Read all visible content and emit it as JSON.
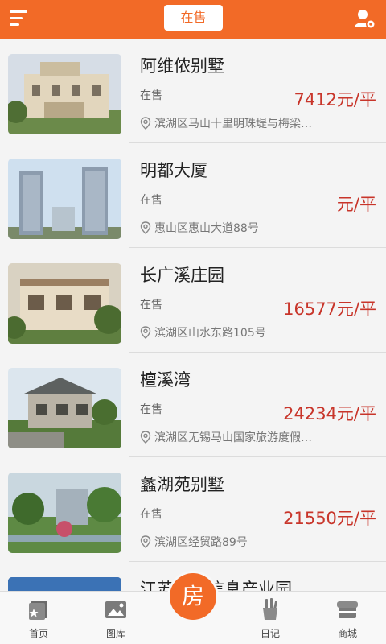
{
  "header": {
    "title": "在售",
    "menu_icon": "hamburger-icon",
    "settings_icon": "user-settings-icon",
    "accent_color": "#f26a27"
  },
  "listings": [
    {
      "name": "阿维侬别墅",
      "status": "在售",
      "price": "7412元/平",
      "address": "滨湖区马山十里明珠堤与梅梁…"
    },
    {
      "name": "明都大厦",
      "status": "在售",
      "price": "元/平",
      "address": "惠山区惠山大道88号"
    },
    {
      "name": "长广溪庄园",
      "status": "在售",
      "price": "16577元/平",
      "address": "滨湖区山水东路105号"
    },
    {
      "name": "檀溪湾",
      "status": "在售",
      "price": "24234元/平",
      "address": "滨湖区无锡马山国家旅游度假…"
    },
    {
      "name": "蠡湖苑别墅",
      "status": "在售",
      "price": "21550元/平",
      "address": "滨湖区经贸路89号"
    },
    {
      "name": "江苏数字信息产业园",
      "status": "",
      "price": "",
      "address": ""
    }
  ],
  "tabbar": {
    "home": "首页",
    "gallery": "图库",
    "center": "房",
    "diary": "日记",
    "mall": "商城"
  },
  "colors": {
    "price": "#c8352a",
    "text": "#222222",
    "secondary": "#777777"
  }
}
